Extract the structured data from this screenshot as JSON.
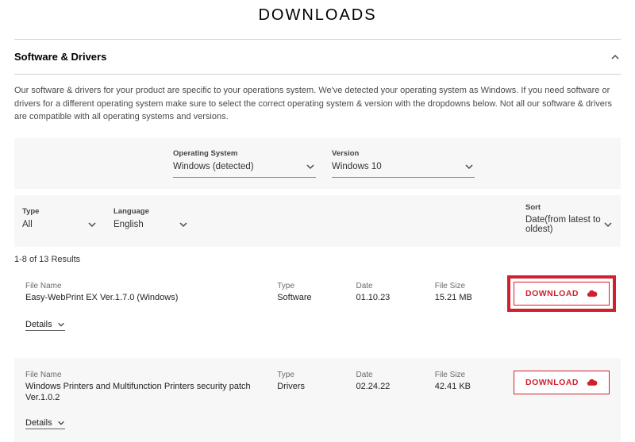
{
  "page": {
    "title": "DOWNLOADS"
  },
  "accordion": {
    "title": "Software & Drivers"
  },
  "intro": "Our software & drivers for your product are specific to your operations system. We've detected your operating system as Windows. If you need software or drivers for a different operating system make sure to select the correct operating system & version with the dropdowns below. Not all our software & drivers are compatible with all operating systems and versions.",
  "os": {
    "label": "Operating System",
    "value": "Windows (detected)"
  },
  "ver": {
    "label": "Version",
    "value": "Windows 10"
  },
  "type": {
    "label": "Type",
    "value": "All"
  },
  "lang": {
    "label": "Language",
    "value": "English"
  },
  "sort": {
    "label": "Sort",
    "value": "Date(from latest to oldest)"
  },
  "results_count": "1-8 of 13 Results",
  "headers": {
    "name": "File Name",
    "type": "Type",
    "date": "Date",
    "size": "File Size"
  },
  "download_label": "DOWNLOAD",
  "details_label": "Details",
  "items": [
    {
      "name": "Easy-WebPrint EX Ver.1.7.0 (Windows)",
      "type": "Software",
      "date": "01.10.23",
      "size": "15.21 MB"
    },
    {
      "name": "Windows Printers and Multifunction Printers security patch Ver.1.0.2",
      "type": "Drivers",
      "date": "02.24.22",
      "size": "42.41 KB"
    }
  ]
}
